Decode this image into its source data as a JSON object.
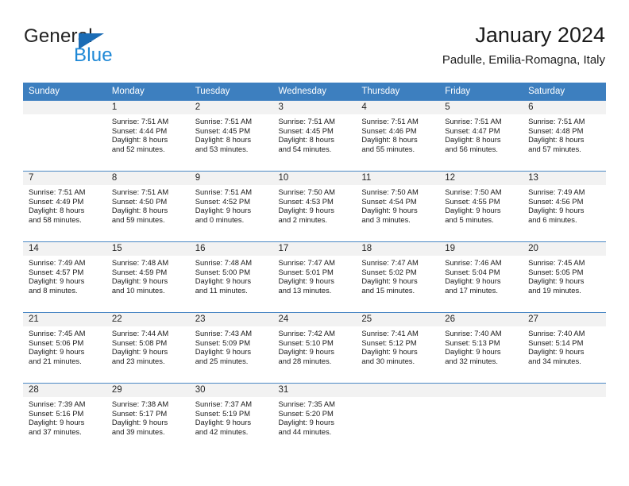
{
  "logo": {
    "word_one": "General",
    "word_two": "Blue",
    "flag_color": "#1b6cb5",
    "blue_text_color": "#1e88d6"
  },
  "header": {
    "title": "January 2024",
    "subtitle": "Padulle, Emilia-Romagna, Italy"
  },
  "calendar": {
    "header_bg": "#3d7fbf",
    "daynum_bg": "#f2f2f2",
    "weekday_headers": [
      "Sunday",
      "Monday",
      "Tuesday",
      "Wednesday",
      "Thursday",
      "Friday",
      "Saturday"
    ],
    "weeks": [
      [
        {
          "day": "",
          "sunrise": "",
          "sunset": "",
          "daylight_1": "",
          "daylight_2": ""
        },
        {
          "day": "1",
          "sunrise": "Sunrise: 7:51 AM",
          "sunset": "Sunset: 4:44 PM",
          "daylight_1": "Daylight: 8 hours",
          "daylight_2": "and 52 minutes."
        },
        {
          "day": "2",
          "sunrise": "Sunrise: 7:51 AM",
          "sunset": "Sunset: 4:45 PM",
          "daylight_1": "Daylight: 8 hours",
          "daylight_2": "and 53 minutes."
        },
        {
          "day": "3",
          "sunrise": "Sunrise: 7:51 AM",
          "sunset": "Sunset: 4:45 PM",
          "daylight_1": "Daylight: 8 hours",
          "daylight_2": "and 54 minutes."
        },
        {
          "day": "4",
          "sunrise": "Sunrise: 7:51 AM",
          "sunset": "Sunset: 4:46 PM",
          "daylight_1": "Daylight: 8 hours",
          "daylight_2": "and 55 minutes."
        },
        {
          "day": "5",
          "sunrise": "Sunrise: 7:51 AM",
          "sunset": "Sunset: 4:47 PM",
          "daylight_1": "Daylight: 8 hours",
          "daylight_2": "and 56 minutes."
        },
        {
          "day": "6",
          "sunrise": "Sunrise: 7:51 AM",
          "sunset": "Sunset: 4:48 PM",
          "daylight_1": "Daylight: 8 hours",
          "daylight_2": "and 57 minutes."
        }
      ],
      [
        {
          "day": "7",
          "sunrise": "Sunrise: 7:51 AM",
          "sunset": "Sunset: 4:49 PM",
          "daylight_1": "Daylight: 8 hours",
          "daylight_2": "and 58 minutes."
        },
        {
          "day": "8",
          "sunrise": "Sunrise: 7:51 AM",
          "sunset": "Sunset: 4:50 PM",
          "daylight_1": "Daylight: 8 hours",
          "daylight_2": "and 59 minutes."
        },
        {
          "day": "9",
          "sunrise": "Sunrise: 7:51 AM",
          "sunset": "Sunset: 4:52 PM",
          "daylight_1": "Daylight: 9 hours",
          "daylight_2": "and 0 minutes."
        },
        {
          "day": "10",
          "sunrise": "Sunrise: 7:50 AM",
          "sunset": "Sunset: 4:53 PM",
          "daylight_1": "Daylight: 9 hours",
          "daylight_2": "and 2 minutes."
        },
        {
          "day": "11",
          "sunrise": "Sunrise: 7:50 AM",
          "sunset": "Sunset: 4:54 PM",
          "daylight_1": "Daylight: 9 hours",
          "daylight_2": "and 3 minutes."
        },
        {
          "day": "12",
          "sunrise": "Sunrise: 7:50 AM",
          "sunset": "Sunset: 4:55 PM",
          "daylight_1": "Daylight: 9 hours",
          "daylight_2": "and 5 minutes."
        },
        {
          "day": "13",
          "sunrise": "Sunrise: 7:49 AM",
          "sunset": "Sunset: 4:56 PM",
          "daylight_1": "Daylight: 9 hours",
          "daylight_2": "and 6 minutes."
        }
      ],
      [
        {
          "day": "14",
          "sunrise": "Sunrise: 7:49 AM",
          "sunset": "Sunset: 4:57 PM",
          "daylight_1": "Daylight: 9 hours",
          "daylight_2": "and 8 minutes."
        },
        {
          "day": "15",
          "sunrise": "Sunrise: 7:48 AM",
          "sunset": "Sunset: 4:59 PM",
          "daylight_1": "Daylight: 9 hours",
          "daylight_2": "and 10 minutes."
        },
        {
          "day": "16",
          "sunrise": "Sunrise: 7:48 AM",
          "sunset": "Sunset: 5:00 PM",
          "daylight_1": "Daylight: 9 hours",
          "daylight_2": "and 11 minutes."
        },
        {
          "day": "17",
          "sunrise": "Sunrise: 7:47 AM",
          "sunset": "Sunset: 5:01 PM",
          "daylight_1": "Daylight: 9 hours",
          "daylight_2": "and 13 minutes."
        },
        {
          "day": "18",
          "sunrise": "Sunrise: 7:47 AM",
          "sunset": "Sunset: 5:02 PM",
          "daylight_1": "Daylight: 9 hours",
          "daylight_2": "and 15 minutes."
        },
        {
          "day": "19",
          "sunrise": "Sunrise: 7:46 AM",
          "sunset": "Sunset: 5:04 PM",
          "daylight_1": "Daylight: 9 hours",
          "daylight_2": "and 17 minutes."
        },
        {
          "day": "20",
          "sunrise": "Sunrise: 7:45 AM",
          "sunset": "Sunset: 5:05 PM",
          "daylight_1": "Daylight: 9 hours",
          "daylight_2": "and 19 minutes."
        }
      ],
      [
        {
          "day": "21",
          "sunrise": "Sunrise: 7:45 AM",
          "sunset": "Sunset: 5:06 PM",
          "daylight_1": "Daylight: 9 hours",
          "daylight_2": "and 21 minutes."
        },
        {
          "day": "22",
          "sunrise": "Sunrise: 7:44 AM",
          "sunset": "Sunset: 5:08 PM",
          "daylight_1": "Daylight: 9 hours",
          "daylight_2": "and 23 minutes."
        },
        {
          "day": "23",
          "sunrise": "Sunrise: 7:43 AM",
          "sunset": "Sunset: 5:09 PM",
          "daylight_1": "Daylight: 9 hours",
          "daylight_2": "and 25 minutes."
        },
        {
          "day": "24",
          "sunrise": "Sunrise: 7:42 AM",
          "sunset": "Sunset: 5:10 PM",
          "daylight_1": "Daylight: 9 hours",
          "daylight_2": "and 28 minutes."
        },
        {
          "day": "25",
          "sunrise": "Sunrise: 7:41 AM",
          "sunset": "Sunset: 5:12 PM",
          "daylight_1": "Daylight: 9 hours",
          "daylight_2": "and 30 minutes."
        },
        {
          "day": "26",
          "sunrise": "Sunrise: 7:40 AM",
          "sunset": "Sunset: 5:13 PM",
          "daylight_1": "Daylight: 9 hours",
          "daylight_2": "and 32 minutes."
        },
        {
          "day": "27",
          "sunrise": "Sunrise: 7:40 AM",
          "sunset": "Sunset: 5:14 PM",
          "daylight_1": "Daylight: 9 hours",
          "daylight_2": "and 34 minutes."
        }
      ],
      [
        {
          "day": "28",
          "sunrise": "Sunrise: 7:39 AM",
          "sunset": "Sunset: 5:16 PM",
          "daylight_1": "Daylight: 9 hours",
          "daylight_2": "and 37 minutes."
        },
        {
          "day": "29",
          "sunrise": "Sunrise: 7:38 AM",
          "sunset": "Sunset: 5:17 PM",
          "daylight_1": "Daylight: 9 hours",
          "daylight_2": "and 39 minutes."
        },
        {
          "day": "30",
          "sunrise": "Sunrise: 7:37 AM",
          "sunset": "Sunset: 5:19 PM",
          "daylight_1": "Daylight: 9 hours",
          "daylight_2": "and 42 minutes."
        },
        {
          "day": "31",
          "sunrise": "Sunrise: 7:35 AM",
          "sunset": "Sunset: 5:20 PM",
          "daylight_1": "Daylight: 9 hours",
          "daylight_2": "and 44 minutes."
        },
        {
          "day": "",
          "sunrise": "",
          "sunset": "",
          "daylight_1": "",
          "daylight_2": ""
        },
        {
          "day": "",
          "sunrise": "",
          "sunset": "",
          "daylight_1": "",
          "daylight_2": ""
        },
        {
          "day": "",
          "sunrise": "",
          "sunset": "",
          "daylight_1": "",
          "daylight_2": ""
        }
      ]
    ]
  }
}
